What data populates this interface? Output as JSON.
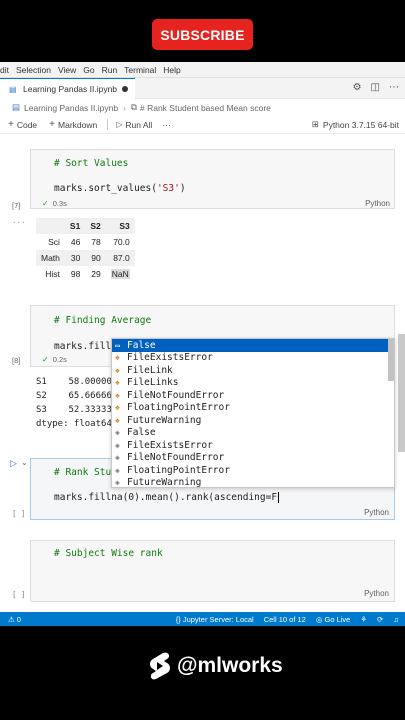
{
  "overlay": {
    "subscribe_label": "SUBSCRIBE",
    "watermark_handle": "@mlworks"
  },
  "menubar": [
    "dit",
    "Selection",
    "View",
    "Go",
    "Run",
    "Terminal",
    "Help"
  ],
  "tab": {
    "title": "Learning Pandas II.ipynb"
  },
  "breadcrumb": {
    "file": "Learning Pandas II.ipynb",
    "section": "# Rank Student based Mean score"
  },
  "toolbar": {
    "code": "Code",
    "markdown": "Markdown",
    "run_all": "Run All",
    "more": "···",
    "kernel": "Python 3.7.15 64-bit"
  },
  "cells": {
    "sort": {
      "comment": "# Sort Values",
      "code_prefix": "marks.sort_values(",
      "code_str": "'S3'",
      "code_suffix": ")",
      "count": "[7]",
      "time": "0.3s",
      "lang": "Python"
    },
    "avg": {
      "comment": "# Finding Average",
      "code": "marks.fillna",
      "count": "[8]",
      "time": "0.2s"
    },
    "rank": {
      "comment": "# Rank Stu",
      "code": "marks.fillna(0).mean().rank(ascending=F",
      "gutter": "[ ]",
      "lang": "Python"
    },
    "subject": {
      "comment": "# Subject Wise rank",
      "gutter": "[ ]",
      "lang": "Python"
    }
  },
  "dataframe": {
    "columns": [
      "",
      "S1",
      "S2",
      "S3"
    ],
    "rows": [
      [
        "Sci",
        "46",
        "78",
        "70.0"
      ],
      [
        "Math",
        "30",
        "90",
        "87.0"
      ],
      [
        "Hist",
        "98",
        "29",
        "NaN"
      ]
    ]
  },
  "series_output": [
    "S1    58.00000",
    "S2    65.66666",
    "S3    52.33333",
    "dtype: float64"
  ],
  "autocomplete": [
    {
      "label": "False",
      "kind": "keyword",
      "selected": true
    },
    {
      "label": "FileExistsError",
      "kind": "class"
    },
    {
      "label": "FileLink",
      "kind": "class"
    },
    {
      "label": "FileLinks",
      "kind": "class"
    },
    {
      "label": "FileNotFoundError",
      "kind": "class"
    },
    {
      "label": "FloatingPointError",
      "kind": "class"
    },
    {
      "label": "FutureWarning",
      "kind": "class"
    },
    {
      "label": "False",
      "kind": "value"
    },
    {
      "label": "FileExistsError",
      "kind": "value"
    },
    {
      "label": "FileNotFoundError",
      "kind": "value"
    },
    {
      "label": "FloatingPointError",
      "kind": "value"
    },
    {
      "label": "FutureWarning",
      "kind": "value"
    }
  ],
  "statusbar": {
    "problems": "0",
    "server": "Jupyter Server: Local",
    "cell": "Cell 10 of 12",
    "golive": "Go Live"
  },
  "colors": {
    "accent": "#007acc",
    "subscribe": "#e6231e",
    "selection": "#0060c0",
    "comment": "#0f7a0f"
  }
}
